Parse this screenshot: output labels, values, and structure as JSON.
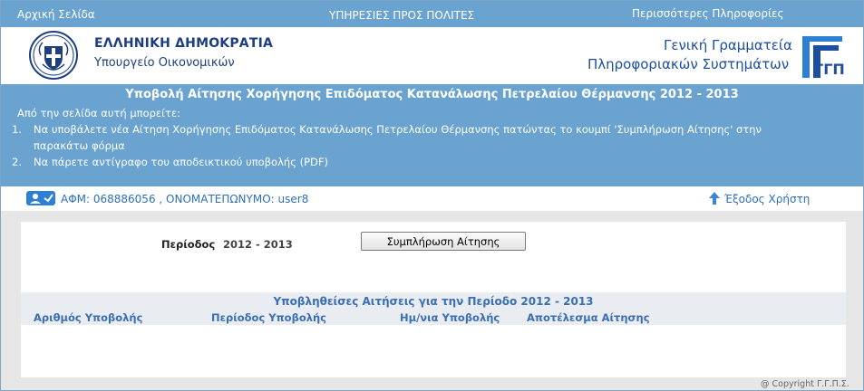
{
  "topbar": {
    "home": "Αρχική Σελίδα",
    "services": "ΥΠΗΡΕΣΙΕΣ ΠΡΟΣ ΠΟΛΙΤΕΣ",
    "more_info": "Περισσότερες Πληροφορίες"
  },
  "header": {
    "republic": "ΕΛΛΗΝΙΚΗ ΔΗΜΟΚΡΑΤΙΑ",
    "ministry": "Υπουργείο Οικονομικών",
    "gsis_line1": "Γενική Γραμματεία",
    "gsis_line2": "Πληροφοριακών Συστημάτων",
    "gsis_logo_text": "ΓΓΠΣ"
  },
  "panel": {
    "title": "Υποβολή Αίτησης Χορήγησης Επιδόματος Κατανάλωσης Πετρελαίου Θέρμανσης 2012 - 2013",
    "intro": "Από την σελίδα αυτή μπορείτε:",
    "item1_num": "1.",
    "item1_line1": "Να υποβάλετε νέα Αίτηση Χορήγησης Επιδόματος Κατανάλωσης Πετρελαίου Θέρμανσης πατώντας το κουμπί 'Συμπλήρωση Αίτησης' στην",
    "item1_line2": "παρακάτω φόρμα",
    "item2_num": "2.",
    "item2": "Να πάρετε αντίγραφο του αποδεικτικού υποβολής (PDF)"
  },
  "user": {
    "info": "ΑΦΜ: 068886056 , ΟΝΟΜΑΤΕΠΩΝΥΜΟ: user8",
    "logout": "Έξοδος Χρήστη"
  },
  "form": {
    "period_label": "Περίοδος",
    "period_value": "2012 - 2013",
    "fill_button": "Συμπλήρωση Αίτησης"
  },
  "submissions": {
    "title": "Υποβληθείσες Αιτήσεις για την Περίοδο 2012 - 2013",
    "columns": [
      "Αριθμός Υποβολής",
      "Περίοδος Υποβολής",
      "Ημ/νια Υποβολής",
      "Αποτέλεσμα Αίτησης"
    ]
  },
  "footer": {
    "copyright": "@ Copyright Γ.Γ.Π.Σ."
  },
  "colors": {
    "primary_blue": "#6aa3cf",
    "link_blue": "#2e6fb8",
    "dark_blue": "#1d3e7f"
  }
}
